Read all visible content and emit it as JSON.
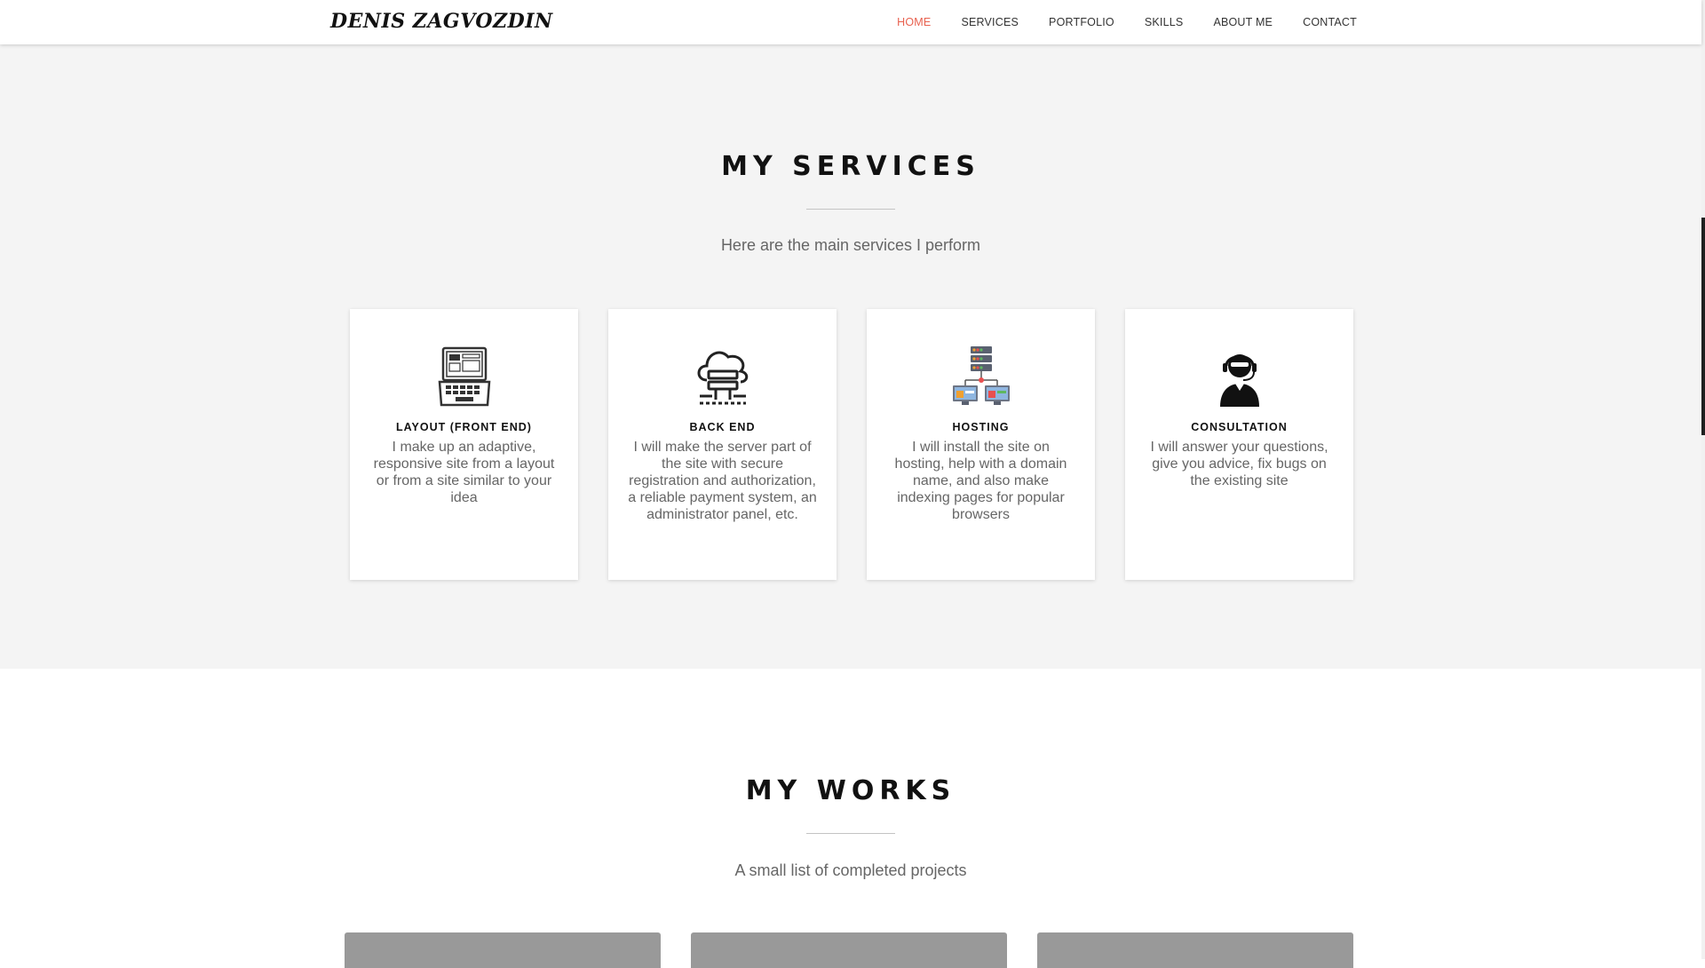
{
  "nav": {
    "brand": "DENIS ZAGVOZDIN",
    "links": [
      {
        "label": "HOME",
        "active": true
      },
      {
        "label": "SERVICES"
      },
      {
        "label": "PORTFOLIO"
      },
      {
        "label": "SKILLS"
      },
      {
        "label": "ABOUT ME"
      },
      {
        "label": "CONTACT"
      }
    ]
  },
  "services": {
    "title": "MY SERVICES",
    "subtitle": "Here are the main services I perform",
    "cards": [
      {
        "icon": "laptop-layout-icon",
        "title": "LAYOUT (FRONT END)",
        "text": "I make up an adaptive, responsive site from a layout or from a site similar to your idea"
      },
      {
        "icon": "cloud-server-icon",
        "title": "BACK END",
        "text": "I will make the server part of the site with secure registration and authorization, a reliable payment system, an administrator panel, etc."
      },
      {
        "icon": "hosting-network-icon",
        "title": "HOSTING",
        "text": "I will install the site on hosting, help with a domain name, and also make indexing pages for popular browsers"
      },
      {
        "icon": "support-agent-icon",
        "title": "CONSULTATION",
        "text": "I will answer your questions, give you advice, fix bugs on the existing site"
      }
    ]
  },
  "works": {
    "title": "MY WORKS",
    "subtitle": "A small list of completed projects"
  },
  "colors": {
    "accent": "#e8614f",
    "section_bg": "#f4f4f4",
    "thumb_bg": "#999999"
  }
}
